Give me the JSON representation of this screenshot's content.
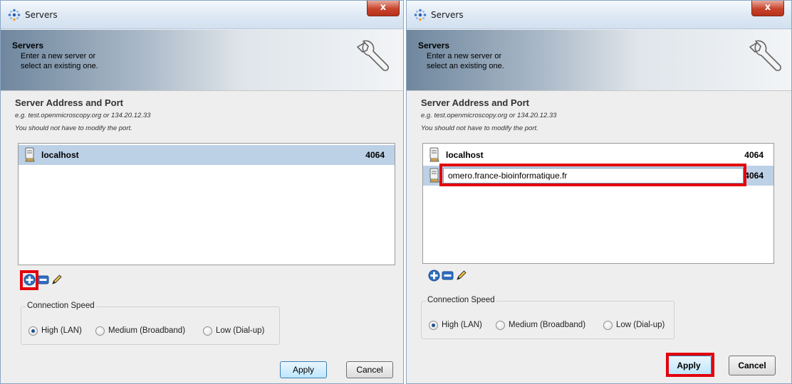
{
  "left_window": {
    "title": "Servers",
    "close_glyph": "x",
    "banner": {
      "title": "Servers",
      "line1": "Enter a new server or",
      "line2": "select an existing one.",
      "icon": "wrench-icon"
    },
    "section_title": "Server Address and Port",
    "hint1": "e.g. test.openmicroscopy.org or 134.20.12.33",
    "hint2": "You should not have to modify the port.",
    "servers": [
      {
        "host": "localhost",
        "port": "4064",
        "selected": true
      }
    ],
    "toolbar_icons": [
      "add-icon",
      "remove-icon",
      "edit-pencil-icon"
    ],
    "connection_speed": {
      "legend": "Connection Speed",
      "options": [
        "High (LAN)",
        "Medium (Broadband)",
        "Low (Dial-up)"
      ],
      "selected": "High (LAN)"
    },
    "apply_label": "Apply",
    "cancel_label": "Cancel",
    "highlighted": "add-button"
  },
  "right_window": {
    "title": "Servers",
    "close_glyph": "x",
    "banner": {
      "title": "Servers",
      "line1": "Enter a new server or",
      "line2": "select an existing one.",
      "icon": "wrench-icon"
    },
    "section_title": "Server Address and Port",
    "hint1": "e.g. test.openmicroscopy.org or 134.20.12.33",
    "hint2": "You should not have to modify the port.",
    "servers": [
      {
        "host": "localhost",
        "port": "4064",
        "selected": false
      },
      {
        "host": "omero.france-bioinformatique.fr",
        "port": "4064",
        "selected": true,
        "editing": true
      }
    ],
    "toolbar_icons": [
      "add-icon",
      "remove-icon",
      "edit-pencil-icon"
    ],
    "connection_speed": {
      "legend": "Connection Speed",
      "options": [
        "High (LAN)",
        "Medium (Broadband)",
        "Low (Dial-up)"
      ],
      "selected": "High (LAN)"
    },
    "apply_label": "Apply",
    "cancel_label": "Cancel",
    "highlighted": [
      "server-address-edit-field",
      "apply-button"
    ]
  },
  "colors": {
    "highlight": "#e3000b",
    "selection": "#bcd0e6",
    "close_button": "#c8432b"
  }
}
